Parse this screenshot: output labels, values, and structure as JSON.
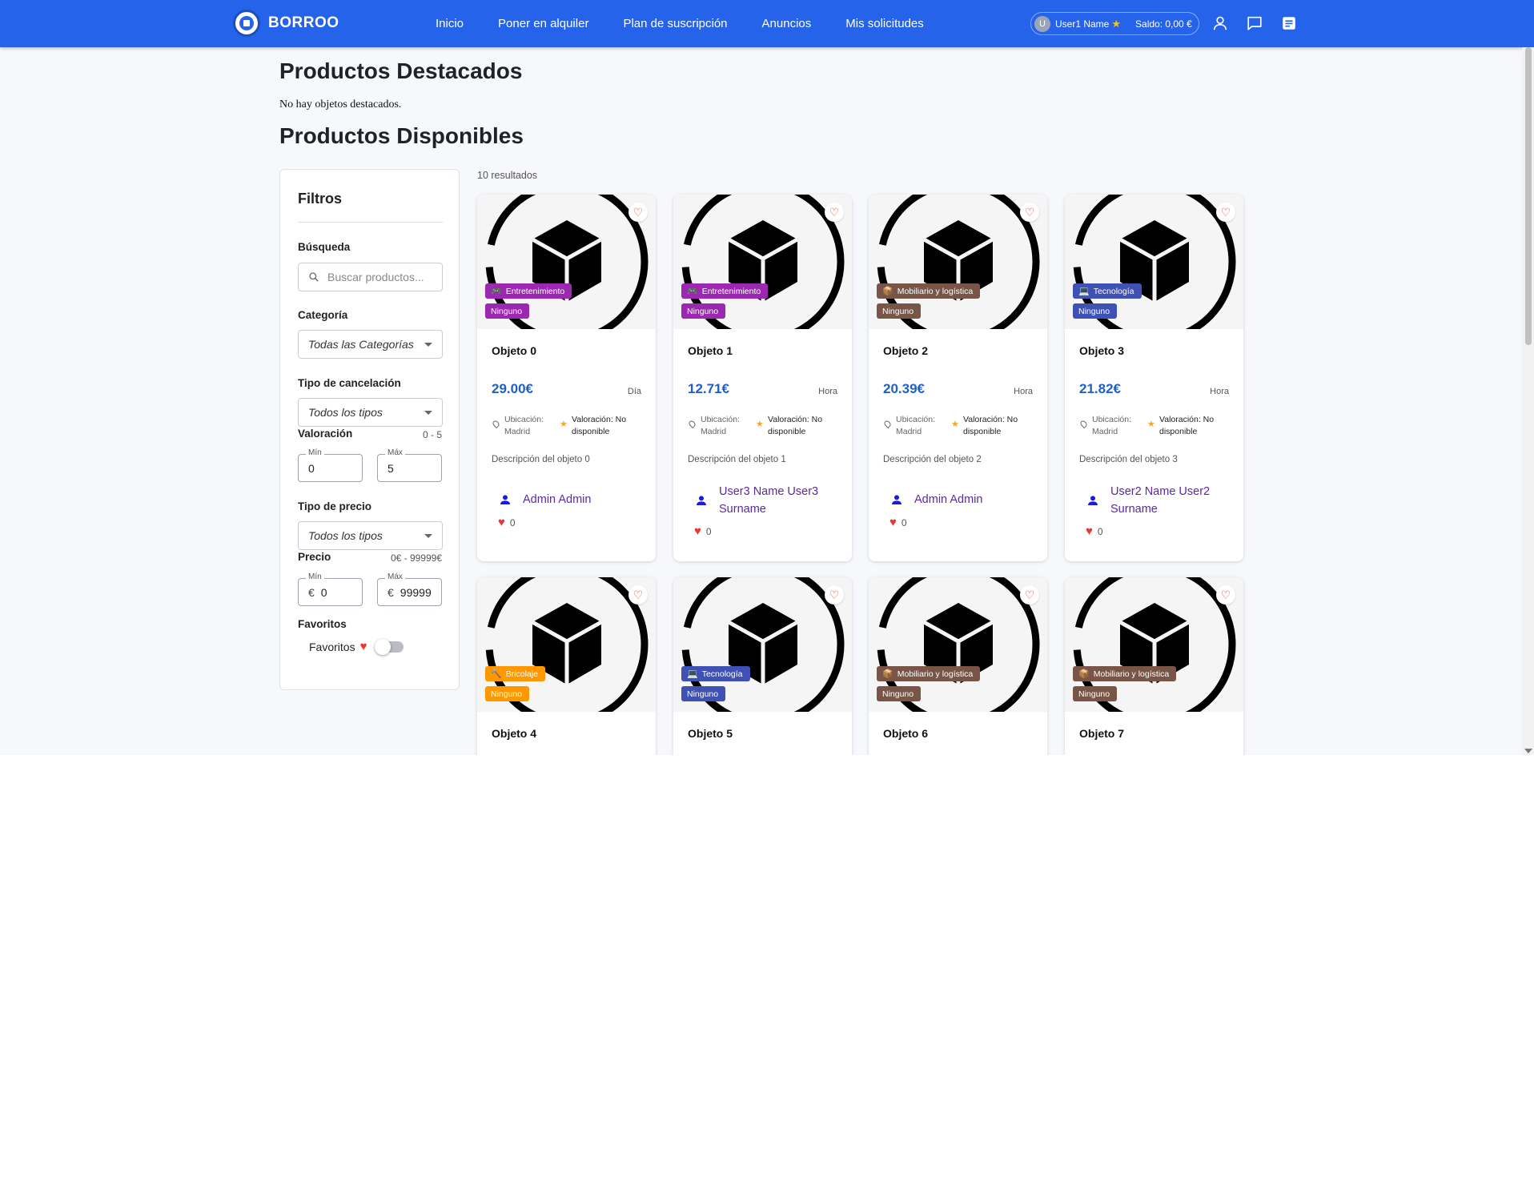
{
  "brand": {
    "name": "BORROO"
  },
  "nav": {
    "links": [
      "Inicio",
      "Poner en alquiler",
      "Plan de suscripción",
      "Anuncios",
      "Mis solicitudes"
    ],
    "user": {
      "initial": "U",
      "name": "User1 Name",
      "balance": "Saldo: 0,00 €"
    },
    "icons": [
      "user-icon",
      "chat-icon",
      "notes-icon"
    ]
  },
  "featured": {
    "title": "Productos Destacados",
    "empty": "No hay objetos destacados."
  },
  "available": {
    "title": "Productos Disponibles",
    "results": "10 resultados"
  },
  "filters": {
    "title": "Filtros",
    "search_label": "Búsqueda",
    "search_placeholder": "Buscar productos...",
    "category_label": "Categoría",
    "category_value": "Todas las Categorías",
    "cancel_label": "Tipo de cancelación",
    "cancel_value": "Todos los tipos",
    "rating_label": "Valoración",
    "rating_range": "0 - 5",
    "rating_min_legend": "Mín",
    "rating_min": "0",
    "rating_max_legend": "Máx",
    "rating_max": "5",
    "price_type_label": "Tipo de precio",
    "price_type_value": "Todos los tipos",
    "price_label": "Precio",
    "price_range": "0€ - 99999€",
    "price_min_legend": "Mín",
    "price_min": "0",
    "price_max_legend": "Máx",
    "price_max": "99999",
    "currency": "€",
    "favorites_label": "Favoritos",
    "favorites_toggle_label": "Favoritos"
  },
  "cards": [
    {
      "title": "Objeto 0",
      "category": "Entretenimiento",
      "category_color": "#9c27b0",
      "category_icon": "gamepad-icon",
      "cancel": "Ninguno",
      "price": "29.00€",
      "unit": "Día",
      "location_label": "Ubicación:",
      "location": "Madrid",
      "rating_label": "Valoración: No disponible",
      "description": "Descripción del objeto 0",
      "owner": "Admin Admin",
      "likes": "0"
    },
    {
      "title": "Objeto 1",
      "category": "Entretenimiento",
      "category_color": "#9c27b0",
      "category_icon": "gamepad-icon",
      "cancel": "Ninguno",
      "price": "12.71€",
      "unit": "Hora",
      "location_label": "Ubicación:",
      "location": "Madrid",
      "rating_label": "Valoración: No disponible",
      "description": "Descripción del objeto 1",
      "owner": "User3 Name User3 Surname",
      "likes": "0"
    },
    {
      "title": "Objeto 2",
      "category": "Mobiliario y logística",
      "category_color": "#795548",
      "category_icon": "box-icon",
      "cancel": "Ninguno",
      "price": "20.39€",
      "unit": "Hora",
      "location_label": "Ubicación:",
      "location": "Madrid",
      "rating_label": "Valoración: No disponible",
      "description": "Descripción del objeto 2",
      "owner": "Admin Admin",
      "likes": "0"
    },
    {
      "title": "Objeto 3",
      "category": "Tecnología",
      "category_color": "#3f51b5",
      "category_icon": "laptop-icon",
      "cancel": "Ninguno",
      "price": "21.82€",
      "unit": "Hora",
      "location_label": "Ubicación:",
      "location": "Madrid",
      "rating_label": "Valoración: No disponible",
      "description": "Descripción del objeto 3",
      "owner": "User2 Name User2 Surname",
      "likes": "0"
    },
    {
      "title": "Objeto 4",
      "category": "Bricolaje",
      "category_color": "#ff9800",
      "category_icon": "tools-icon",
      "cancel": "Ninguno"
    },
    {
      "title": "Objeto 5",
      "category": "Tecnología",
      "category_color": "#3f51b5",
      "category_icon": "laptop-icon",
      "cancel": "Ninguno"
    },
    {
      "title": "Objeto 6",
      "category": "Mobiliario y logística",
      "category_color": "#795548",
      "category_icon": "box-icon",
      "cancel": "Ninguno"
    },
    {
      "title": "Objeto 7",
      "category": "Mobiliario y logística",
      "category_color": "#795548",
      "category_icon": "box-icon",
      "cancel": "Ninguno"
    }
  ]
}
